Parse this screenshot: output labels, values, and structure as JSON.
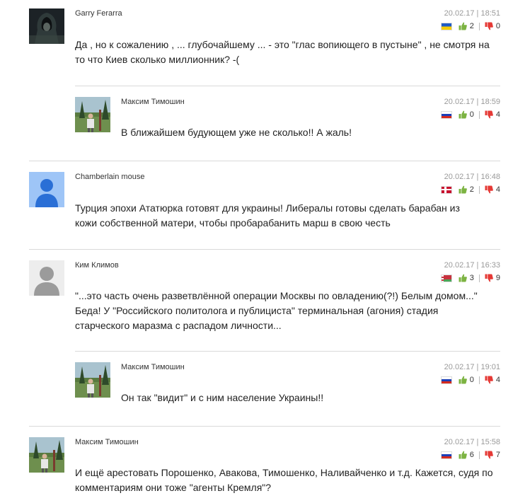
{
  "comments": [
    {
      "author": "Garry Ferarra",
      "date": "20.02.17 | 18:51",
      "likes": "2",
      "dislikes": "0",
      "flag": "ua",
      "avatar": "dark-hooded-figure",
      "text": "Да , но к сожалению , ... глубочайшему ... - это \"глас вопиющего в пустыне\" , не смотря на то что Киев сколько миллионник? -("
    },
    {
      "author": "Максим Тимошин",
      "date": "20.02.17 | 18:59",
      "likes": "0",
      "dislikes": "4",
      "flag": "ru",
      "avatar": "man-outdoors-photo",
      "text": "В ближайшем будующем уже не сколько!! А жаль!"
    },
    {
      "author": "Chamberlain mouse",
      "date": "20.02.17 | 16:48",
      "likes": "2",
      "dislikes": "4",
      "flag": "no",
      "avatar": "default-user-blue",
      "text": "Турция эпохи Ататюрка готовят для украины! Либералы готовы сделать барабан из кожи собственной матери, чтобы пробарабанить марш в свою честь"
    },
    {
      "author": "Ким Климов",
      "date": "20.02.17 | 16:33",
      "likes": "3",
      "dislikes": "9",
      "flag": "by",
      "avatar": "default-user-grey",
      "text": "\"...это часть очень разветвлённой операции Москвы по овладению(?!) Белым домом...\" Беда! У \"Российского политолога и публициста\" терминальная (агония) стадия старческого маразма с распадом личности..."
    },
    {
      "author": "Максим Тимошин",
      "date": "20.02.17 | 19:01",
      "likes": "0",
      "dislikes": "4",
      "flag": "ru",
      "avatar": "man-outdoors-photo",
      "text": "Он так \"видит\" и с ним население Украины!!"
    },
    {
      "author": "Максим Тимошин",
      "date": "20.02.17 | 15:58",
      "likes": "6",
      "dislikes": "7",
      "flag": "ru",
      "avatar": "man-outdoors-photo",
      "text": "И ещё арестовать Порошенко, Авакова, Тимошенко, Наливайченко и т.д. Кажется, судя по комментариям они тоже \"агенты Кремля\"?"
    }
  ],
  "colors": {
    "like": "#7cb342",
    "dislike": "#e53935",
    "divider": "#d9d9d9",
    "date": "#9a9a9a"
  }
}
